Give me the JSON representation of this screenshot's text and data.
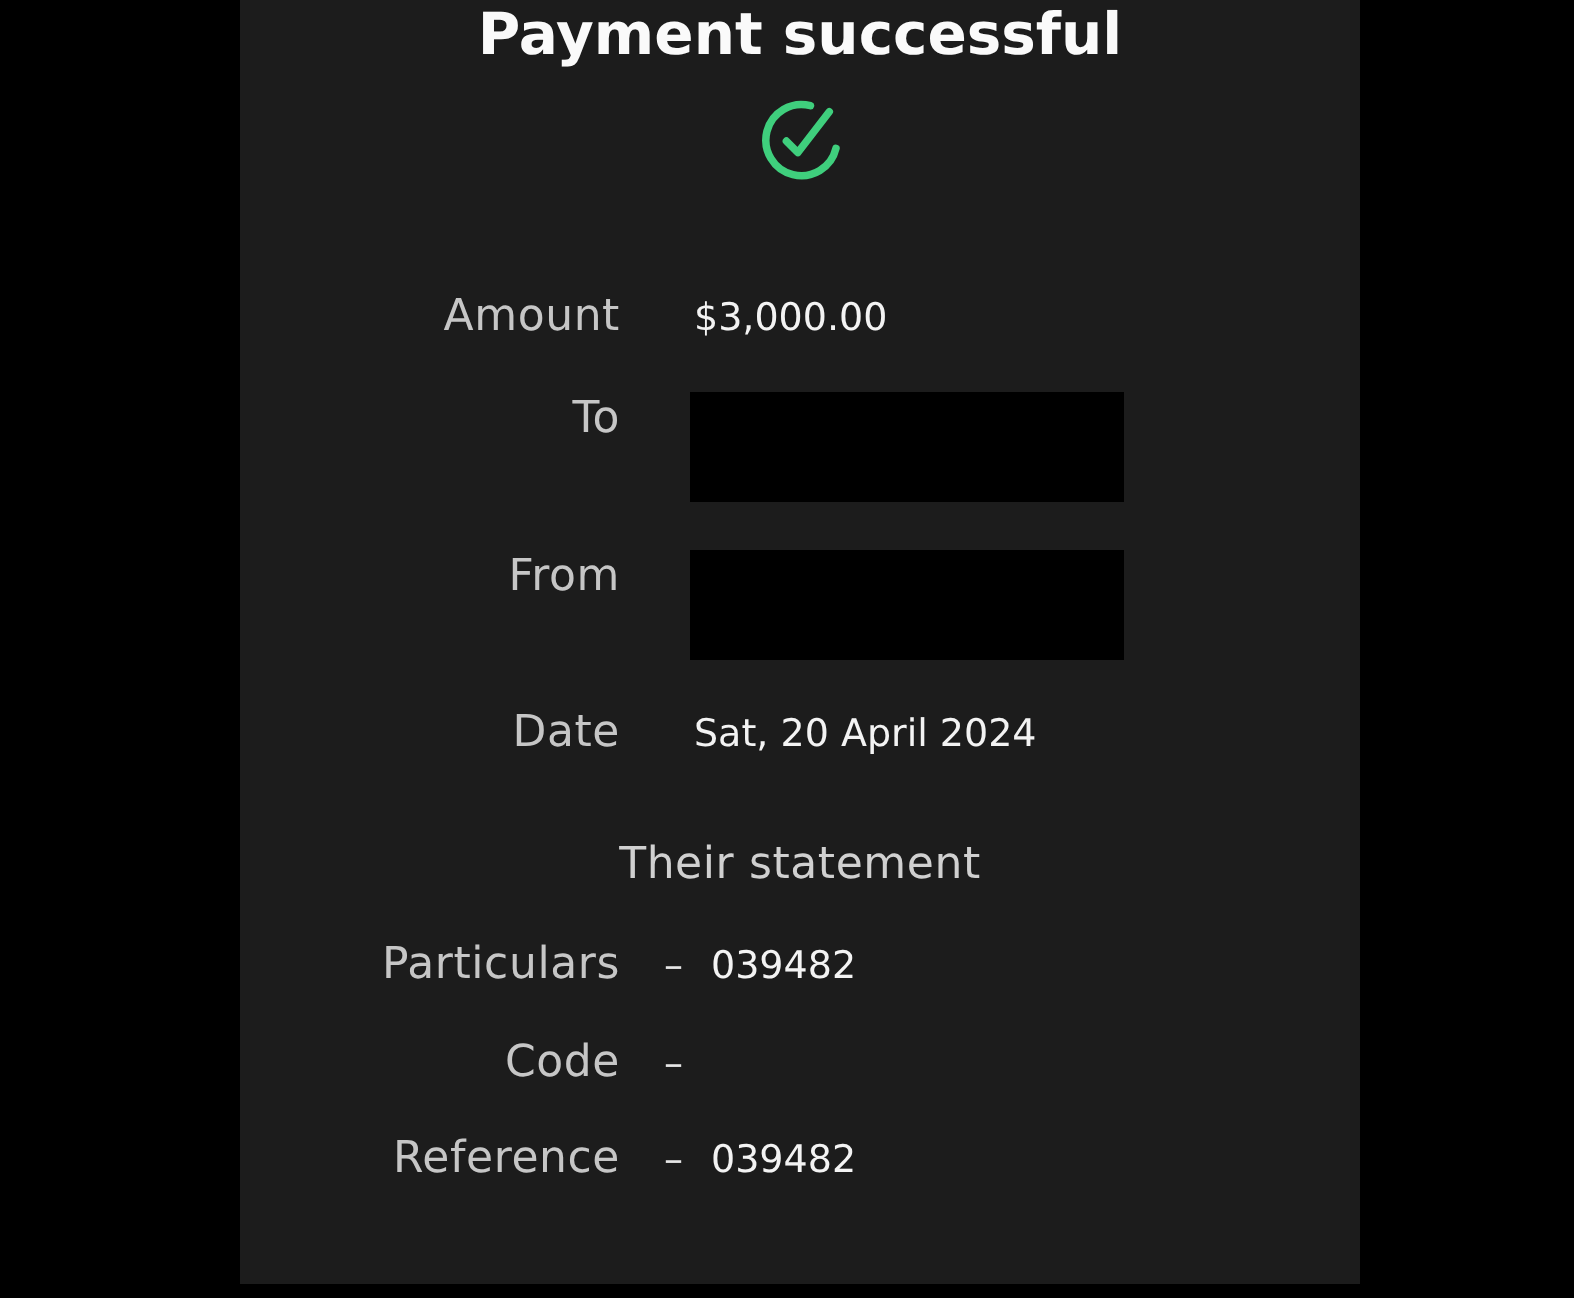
{
  "title": "Payment successful",
  "details": [
    {
      "label": "Amount",
      "kind": "text",
      "value": "$3,000.00"
    },
    {
      "label": "To",
      "kind": "redacted"
    },
    {
      "label": "From",
      "kind": "redacted"
    },
    {
      "label": "Date",
      "kind": "text",
      "value": "Sat, 20 April 2024"
    }
  ],
  "statement": {
    "heading": "Their statement",
    "rows": [
      {
        "label": "Particulars",
        "separator": "–",
        "value": "039482"
      },
      {
        "label": "Code",
        "separator": "–"
      },
      {
        "label": "Reference",
        "separator": "–",
        "value": "039482"
      }
    ]
  }
}
